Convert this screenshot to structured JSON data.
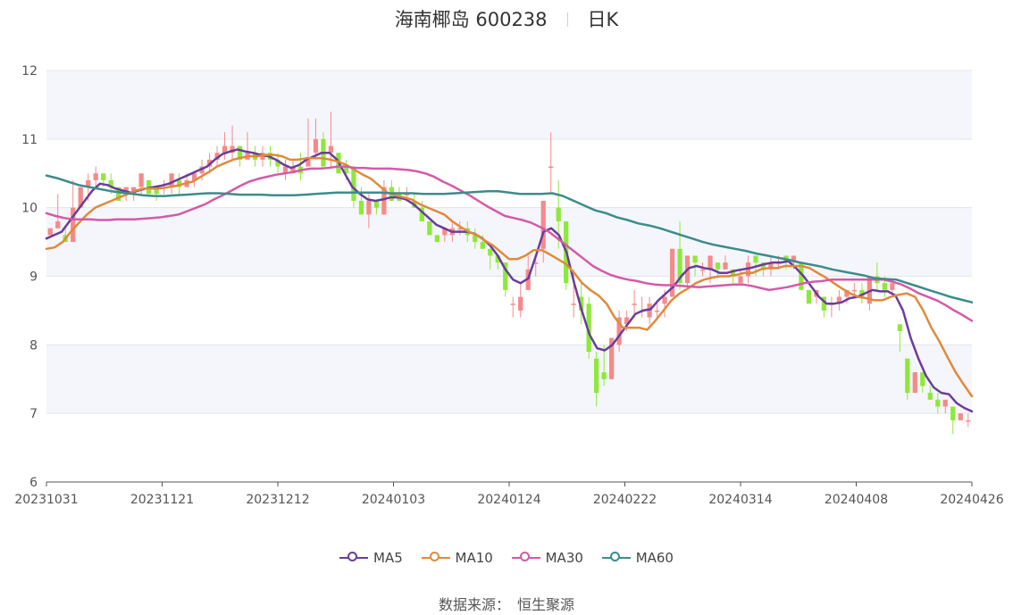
{
  "header": {
    "stock": "海南椰岛 600238",
    "period": "日K"
  },
  "source": {
    "label": "数据来源：",
    "value": "恒生聚源"
  },
  "colors": {
    "up": "#f58a8a",
    "down": "#8ee83c",
    "MA5": "#6a3d9a",
    "MA10": "#e08a3c",
    "MA30": "#d45aa8",
    "MA60": "#3c8c8c"
  },
  "chart_data": {
    "type": "candlestick",
    "title": "海南椰岛 600238 日K",
    "ylim": [
      6,
      12
    ],
    "yticks": [
      "6",
      "7",
      "8",
      "9",
      "10",
      "11",
      "12"
    ],
    "xticks": [
      "20231031",
      "20231121",
      "20231212",
      "20240103",
      "20240124",
      "20240222",
      "20240314",
      "20240408",
      "20240426"
    ],
    "grid": "horizontal",
    "legend_position": "bottom-center",
    "candles": [
      [
        9.6,
        9.7,
        9.7,
        9.6
      ],
      [
        9.7,
        9.8,
        10.2,
        9.7
      ],
      [
        9.6,
        9.5,
        9.7,
        9.5
      ],
      [
        9.5,
        10,
        10.4,
        9.5
      ],
      [
        10,
        10.3,
        10.3,
        10
      ],
      [
        10.3,
        10.4,
        10.5,
        10.1
      ],
      [
        10.4,
        10.5,
        10.6,
        10.3
      ],
      [
        10.5,
        10.4,
        10.5,
        10.3
      ],
      [
        10.4,
        10.3,
        10.5,
        10.2
      ],
      [
        10.3,
        10.1,
        10.3,
        10.1
      ],
      [
        10.2,
        10.3,
        10.3,
        10.1
      ],
      [
        10.2,
        10.3,
        10.3,
        10.1
      ],
      [
        10.3,
        10.5,
        10.5,
        10.2
      ],
      [
        10.4,
        10.2,
        10.4,
        10.2
      ],
      [
        10.3,
        10.2,
        10.3,
        10.1
      ],
      [
        10.3,
        10.3,
        10.4,
        10.2
      ],
      [
        10.3,
        10.5,
        10.5,
        10.2
      ],
      [
        10.4,
        10.3,
        10.5,
        10.2
      ],
      [
        10.3,
        10.4,
        10.5,
        10.3
      ],
      [
        10.4,
        10.5,
        10.5,
        10.3
      ],
      [
        10.5,
        10.6,
        10.7,
        10.4
      ],
      [
        10.6,
        10.7,
        10.8,
        10.5
      ],
      [
        10.7,
        10.8,
        10.9,
        10.6
      ],
      [
        10.8,
        10.9,
        11.1,
        10.7
      ],
      [
        10.8,
        10.9,
        11.2,
        10.7
      ],
      [
        10.9,
        10.7,
        10.9,
        10.6
      ],
      [
        10.7,
        10.8,
        11.1,
        10.7
      ],
      [
        10.8,
        10.7,
        10.9,
        10.6
      ],
      [
        10.7,
        10.8,
        10.9,
        10.6
      ],
      [
        10.8,
        10.7,
        10.9,
        10.6
      ],
      [
        10.7,
        10.6,
        10.8,
        10.5
      ],
      [
        10.5,
        10.6,
        10.7,
        10.4
      ],
      [
        10.5,
        10.6,
        10.7,
        10.5
      ],
      [
        10.6,
        10.5,
        10.8,
        10.4
      ],
      [
        10.6,
        10.7,
        11.3,
        10.6
      ],
      [
        10.8,
        11,
        11.3,
        10.7
      ],
      [
        11,
        10.6,
        11.1,
        10.6
      ],
      [
        10.8,
        10.9,
        11.4,
        10.6
      ],
      [
        10.8,
        10.5,
        10.8,
        10.5
      ],
      [
        10.6,
        10.5,
        10.7,
        10.4
      ],
      [
        10.6,
        10.1,
        10.6,
        10
      ],
      [
        10.1,
        9.9,
        10.3,
        9.9
      ],
      [
        9.9,
        10.1,
        10.2,
        9.7
      ],
      [
        10.1,
        10,
        10.1,
        9.9
      ],
      [
        9.9,
        10.3,
        10.4,
        9.9
      ],
      [
        10.3,
        10.1,
        10.4,
        10.1
      ],
      [
        10.2,
        10.1,
        10.3,
        10.1
      ],
      [
        10.2,
        10.2,
        10.3,
        10.1
      ],
      [
        10.1,
        10,
        10.2,
        10
      ],
      [
        10,
        9.8,
        10.1,
        9.8
      ],
      [
        9.8,
        9.6,
        9.8,
        9.6
      ],
      [
        9.6,
        9.5,
        9.6,
        9.5
      ],
      [
        9.6,
        9.7,
        9.7,
        9.5
      ],
      [
        9.6,
        9.7,
        9.8,
        9.5
      ],
      [
        9.7,
        9.7,
        9.8,
        9.6
      ],
      [
        9.7,
        9.6,
        9.8,
        9.5
      ],
      [
        9.6,
        9.5,
        9.7,
        9.4
      ],
      [
        9.5,
        9.4,
        9.6,
        9.4
      ],
      [
        9.4,
        9.3,
        9.4,
        9.1
      ],
      [
        9.3,
        9.2,
        9.3,
        9.1
      ],
      [
        9.2,
        8.8,
        9.2,
        8.7
      ],
      [
        8.6,
        8.6,
        8.7,
        8.4
      ],
      [
        8.5,
        8.7,
        8.9,
        8.4
      ],
      [
        8.8,
        9.1,
        9.3,
        8.8
      ],
      [
        9.2,
        9.2,
        9.3,
        9
      ],
      [
        9.4,
        10.1,
        10.1,
        9.2
      ],
      [
        10.6,
        10.6,
        11.1,
        10.2
      ],
      [
        10,
        9.8,
        10.4,
        9.4
      ],
      [
        9.8,
        8.9,
        9.8,
        8.8
      ],
      [
        8.6,
        8.6,
        9.1,
        8.4
      ],
      [
        8.7,
        8.5,
        8.9,
        8.3
      ],
      [
        8.6,
        7.9,
        8.7,
        7.8
      ],
      [
        7.8,
        7.3,
        7.9,
        7.1
      ],
      [
        7.6,
        7.5,
        8,
        7.4
      ],
      [
        7.5,
        8.1,
        8.1,
        7.5
      ],
      [
        8,
        8.4,
        8.5,
        7.9
      ],
      [
        8.3,
        8.4,
        8.5,
        8.2
      ],
      [
        8.6,
        8.6,
        8.8,
        8.4
      ],
      [
        8.5,
        8.5,
        8.7,
        8.4
      ],
      [
        8.4,
        8.6,
        8.7,
        8.3
      ],
      [
        8.5,
        8.5,
        8.6,
        8.4
      ],
      [
        8.6,
        8.7,
        8.8,
        8.4
      ],
      [
        8.7,
        9.4,
        9.4,
        8.7
      ],
      [
        9.4,
        8.9,
        9.8,
        8.8
      ],
      [
        8.9,
        9.3,
        9.3,
        8.8
      ],
      [
        9.3,
        9.2,
        9.3,
        9
      ],
      [
        9.1,
        9.1,
        9.2,
        9
      ],
      [
        9.1,
        9.3,
        9.3,
        8.9
      ],
      [
        9.2,
        9.1,
        9.2,
        9
      ],
      [
        9.1,
        9.2,
        9.3,
        9.1
      ],
      [
        9.1,
        9,
        9.1,
        8.9
      ],
      [
        8.9,
        9,
        9.1,
        8.9
      ],
      [
        9,
        9.2,
        9.3,
        8.9
      ],
      [
        9.3,
        9.2,
        9.3,
        9
      ],
      [
        9.2,
        9.1,
        9.2,
        9
      ],
      [
        9.1,
        9.2,
        9.3,
        9
      ],
      [
        9.2,
        9.2,
        9.3,
        9.1
      ],
      [
        9.3,
        9.2,
        9.3,
        9.1
      ],
      [
        9.2,
        9.3,
        9.3,
        9.1
      ],
      [
        9.2,
        8.8,
        9.2,
        8.8
      ],
      [
        8.8,
        8.6,
        8.8,
        8.6
      ],
      [
        8.7,
        8.8,
        8.8,
        8.6
      ],
      [
        8.7,
        8.5,
        8.7,
        8.4
      ],
      [
        8.6,
        8.6,
        8.7,
        8.4
      ],
      [
        8.6,
        8.7,
        8.8,
        8.5
      ],
      [
        8.7,
        8.8,
        8.8,
        8.6
      ],
      [
        8.8,
        8.8,
        8.9,
        8.7
      ],
      [
        8.8,
        8.7,
        8.9,
        8.6
      ],
      [
        8.6,
        9,
        9,
        8.5
      ],
      [
        9,
        8.9,
        9.2,
        8.8
      ],
      [
        8.9,
        8.8,
        9,
        8.7
      ],
      [
        8.8,
        8.9,
        8.9,
        8.7
      ],
      [
        8.3,
        8.2,
        8.3,
        7.9
      ],
      [
        7.8,
        7.3,
        7.8,
        7.2
      ],
      [
        7.3,
        7.6,
        7.6,
        7.3
      ],
      [
        7.6,
        7.4,
        7.6,
        7.3
      ],
      [
        7.3,
        7.2,
        7.4,
        7.2
      ],
      [
        7.2,
        7.1,
        7.3,
        7
      ],
      [
        7.1,
        7.2,
        7.2,
        7
      ],
      [
        7.1,
        6.9,
        7.1,
        6.7
      ],
      [
        6.9,
        7,
        7,
        6.9
      ],
      [
        6.9,
        6.9,
        7,
        6.8
      ]
    ],
    "series": [
      {
        "name": "MA5",
        "values": [
          9.55,
          9.6,
          9.65,
          9.8,
          9.95,
          10.1,
          10.25,
          10.35,
          10.33,
          10.28,
          10.25,
          10.22,
          10.25,
          10.28,
          10.3,
          10.32,
          10.35,
          10.4,
          10.45,
          10.5,
          10.55,
          10.6,
          10.7,
          10.78,
          10.82,
          10.85,
          10.82,
          10.8,
          10.77,
          10.75,
          10.7,
          10.63,
          10.58,
          10.62,
          10.7,
          10.75,
          10.8,
          10.8,
          10.7,
          10.5,
          10.3,
          10.2,
          10.12,
          10.1,
          10.12,
          10.15,
          10.15,
          10.12,
          10.05,
          9.95,
          9.85,
          9.75,
          9.7,
          9.65,
          9.65,
          9.65,
          9.62,
          9.55,
          9.45,
          9.3,
          9.1,
          8.95,
          8.9,
          8.97,
          9.3,
          9.65,
          9.7,
          9.6,
          9.35,
          8.9,
          8.5,
          8.15,
          7.95,
          7.92,
          8,
          8.15,
          8.3,
          8.45,
          8.5,
          8.52,
          8.65,
          8.75,
          8.85,
          9,
          9.12,
          9.15,
          9.12,
          9.1,
          9.05,
          9.05,
          9.08,
          9.1,
          9.12,
          9.15,
          9.18,
          9.2,
          9.2,
          9.22,
          9.12,
          9,
          8.85,
          8.7,
          8.6,
          8.6,
          8.62,
          8.68,
          8.7,
          8.75,
          8.8,
          8.78,
          8.78,
          8.72,
          8.5,
          8.1,
          7.8,
          7.55,
          7.38,
          7.3,
          7.28,
          7.15,
          7.08,
          7.03
        ]
      },
      {
        "name": "MA10",
        "values": [
          9.4,
          9.42,
          9.5,
          9.65,
          9.78,
          9.9,
          10,
          10.05,
          10.1,
          10.15,
          10.2,
          10.25,
          10.28,
          10.28,
          10.28,
          10.3,
          10.32,
          10.35,
          10.38,
          10.45,
          10.52,
          10.6,
          10.65,
          10.7,
          10.73,
          10.75,
          10.75,
          10.77,
          10.77,
          10.75,
          10.7,
          10.7,
          10.72,
          10.72,
          10.72,
          10.7,
          10.67,
          10.62,
          10.55,
          10.48,
          10.42,
          10.32,
          10.22,
          10.18,
          10.15,
          10.12,
          10.05,
          10,
          9.95,
          9.9,
          9.8,
          9.72,
          9.65,
          9.6,
          9.52,
          9.45,
          9.35,
          9.25,
          9.25,
          9.3,
          9.38,
          9.38,
          9.32,
          9.25,
          9.18,
          9.05,
          8.9,
          8.8,
          8.72,
          8.6,
          8.4,
          8.25,
          8.25,
          8.25,
          8.22,
          8.35,
          8.5,
          8.65,
          8.75,
          8.82,
          8.9,
          8.95,
          8.98,
          9,
          9,
          9.02,
          9.05,
          9.05,
          9.1,
          9.12,
          9.12,
          9.15,
          9.15,
          9.15,
          9.12,
          9.05,
          8.98,
          8.9,
          8.82,
          8.75,
          8.7,
          8.68,
          8.65,
          8.65,
          8.7,
          8.73,
          8.75,
          8.7,
          8.5,
          8.25,
          8.05,
          7.82,
          7.6,
          7.42,
          7.25
        ]
      },
      {
        "name": "MA30",
        "values": [
          9.92,
          9.88,
          9.85,
          9.83,
          9.83,
          9.83,
          9.82,
          9.82,
          9.83,
          9.83,
          9.83,
          9.84,
          9.85,
          9.86,
          9.88,
          9.9,
          9.95,
          10,
          10.05,
          10.12,
          10.18,
          10.25,
          10.32,
          10.38,
          10.42,
          10.45,
          10.48,
          10.5,
          10.52,
          10.55,
          10.57,
          10.57,
          10.58,
          10.6,
          10.6,
          10.58,
          10.58,
          10.57,
          10.57,
          10.57,
          10.56,
          10.55,
          10.53,
          10.5,
          10.45,
          10.38,
          10.32,
          10.25,
          10.18,
          10.1,
          10.02,
          9.95,
          9.88,
          9.85,
          9.82,
          9.78,
          9.72,
          9.65,
          9.55,
          9.45,
          9.35,
          9.25,
          9.15,
          9.08,
          9.02,
          8.98,
          8.95,
          8.93,
          8.9,
          8.88,
          8.87,
          8.87,
          8.86,
          8.85,
          8.84,
          8.85,
          8.86,
          8.87,
          8.88,
          8.88,
          8.86,
          8.83,
          8.8,
          8.82,
          8.84,
          8.87,
          8.9,
          8.92,
          8.93,
          8.95,
          8.95,
          8.95,
          8.95,
          8.95,
          8.95,
          8.95,
          8.92,
          8.88,
          8.82,
          8.75,
          8.7,
          8.65,
          8.58,
          8.5,
          8.43,
          8.35
        ]
      },
      {
        "name": "MA60",
        "values": [
          10.47,
          10.43,
          10.38,
          10.33,
          10.3,
          10.27,
          10.24,
          10.22,
          10.2,
          10.18,
          10.17,
          10.17,
          10.18,
          10.19,
          10.2,
          10.21,
          10.21,
          10.2,
          10.19,
          10.19,
          10.19,
          10.18,
          10.18,
          10.18,
          10.19,
          10.2,
          10.21,
          10.22,
          10.22,
          10.22,
          10.22,
          10.22,
          10.21,
          10.21,
          10.21,
          10.2,
          10.2,
          10.2,
          10.21,
          10.22,
          10.23,
          10.24,
          10.24,
          10.22,
          10.2,
          10.2,
          10.2,
          10.21,
          10.17,
          10.1,
          10.03,
          9.96,
          9.92,
          9.86,
          9.82,
          9.77,
          9.74,
          9.7,
          9.65,
          9.6,
          9.55,
          9.5,
          9.46,
          9.43,
          9.4,
          9.37,
          9.33,
          9.3,
          9.27,
          9.24,
          9.2,
          9.17,
          9.14,
          9.1,
          9.07,
          9.04,
          9.01,
          8.97,
          8.96,
          8.95,
          8.9,
          8.85,
          8.8,
          8.75,
          8.7,
          8.66,
          8.62
        ]
      }
    ]
  }
}
